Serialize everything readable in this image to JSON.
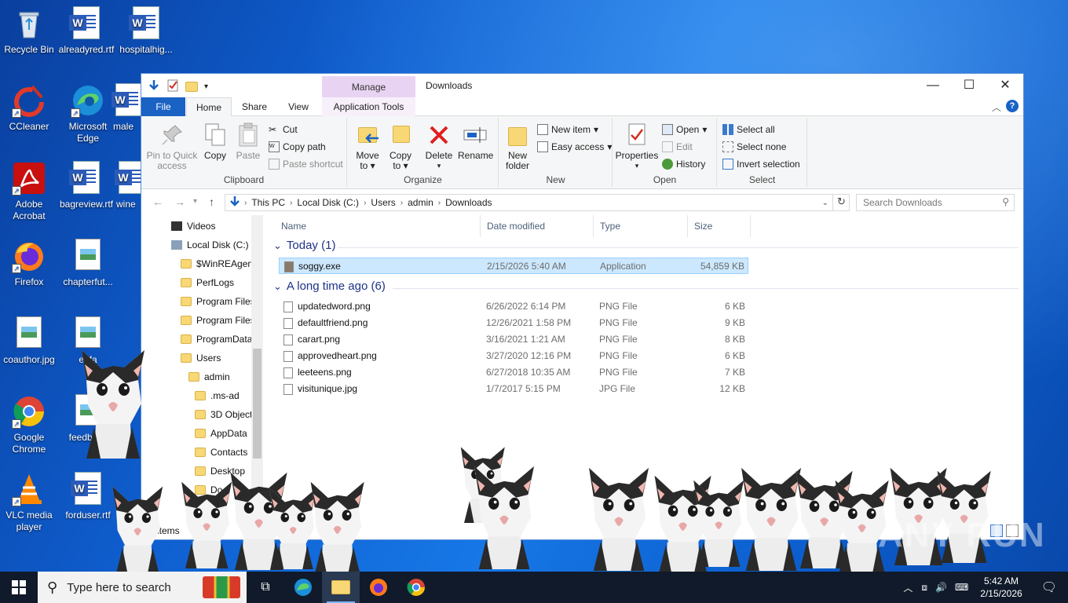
{
  "desktop": {
    "icons": [
      {
        "label": "Recycle Bin",
        "icon": "recycle-bin-icon"
      },
      {
        "label": "alreadyred.rtf",
        "icon": "word-doc-icon"
      },
      {
        "label": "hospitalhig...",
        "icon": "word-doc-icon"
      },
      {
        "label": "CCleaner",
        "icon": "ccleaner-icon"
      },
      {
        "label": "Microsoft Edge",
        "icon": "edge-icon"
      },
      {
        "label": "male",
        "icon": "word-doc-icon"
      },
      {
        "label": "Adobe Acrobat",
        "icon": "acrobat-icon"
      },
      {
        "label": "bagreview.rtf",
        "icon": "word-doc-icon"
      },
      {
        "label": "wine",
        "icon": "word-doc-icon"
      },
      {
        "label": "Firefox",
        "icon": "firefox-icon"
      },
      {
        "label": "chapterfut...",
        "icon": "image-file-icon"
      },
      {
        "label": "coauthor.jpg",
        "icon": "image-file-icon"
      },
      {
        "label": "egfa",
        "icon": "image-file-icon"
      },
      {
        "label": "Google Chrome",
        "icon": "chrome-icon"
      },
      {
        "label": "feedback",
        "icon": "image-file-icon"
      },
      {
        "label": "VLC media player",
        "icon": "vlc-icon"
      },
      {
        "label": "forduser.rtf",
        "icon": "word-doc-icon"
      }
    ]
  },
  "explorer": {
    "title": "Downloads",
    "manage_tab": "Manage",
    "tabs": {
      "file": "File",
      "home": "Home",
      "share": "Share",
      "view": "View",
      "apptools": "Application Tools"
    },
    "ribbon": {
      "clipboard": {
        "label": "Clipboard",
        "pin": "Pin to Quick access",
        "copy": "Copy",
        "paste": "Paste",
        "cut": "Cut",
        "copy_path": "Copy path",
        "paste_shortcut": "Paste shortcut"
      },
      "organize": {
        "label": "Organize",
        "move_to": "Move to",
        "copy_to": "Copy to",
        "delete": "Delete",
        "rename": "Rename"
      },
      "new": {
        "label": "New",
        "new_folder": "New folder",
        "new_item": "New item",
        "easy_access": "Easy access"
      },
      "open": {
        "label": "Open",
        "properties": "Properties",
        "open": "Open",
        "edit": "Edit",
        "history": "History"
      },
      "select": {
        "label": "Select",
        "select_all": "Select all",
        "select_none": "Select none",
        "invert": "Invert selection"
      }
    },
    "address": {
      "crumbs": [
        "This PC",
        "Local Disk (C:)",
        "Users",
        "admin",
        "Downloads"
      ],
      "search_placeholder": "Search Downloads"
    },
    "nav": [
      {
        "label": "Videos",
        "indent": 1
      },
      {
        "label": "Local Disk (C:)",
        "indent": 1
      },
      {
        "label": "$WinREAgent",
        "indent": 2
      },
      {
        "label": "PerfLogs",
        "indent": 2
      },
      {
        "label": "Program Files",
        "indent": 2
      },
      {
        "label": "Program Files",
        "indent": 2
      },
      {
        "label": "ProgramData",
        "indent": 2
      },
      {
        "label": "Users",
        "indent": 2
      },
      {
        "label": "admin",
        "indent": 3
      },
      {
        "label": ".ms-ad",
        "indent": 4
      },
      {
        "label": "3D Objects",
        "indent": 4
      },
      {
        "label": "AppData",
        "indent": 4
      },
      {
        "label": "Contacts",
        "indent": 4
      },
      {
        "label": "Desktop",
        "indent": 4
      },
      {
        "label": "Do",
        "indent": 4
      },
      {
        "label": "Do",
        "indent": 4
      }
    ],
    "columns": {
      "name": "Name",
      "date": "Date modified",
      "type": "Type",
      "size": "Size"
    },
    "groups": [
      {
        "title": "Today (1)",
        "files": [
          {
            "name": "soggy.exe",
            "date": "2/15/2026 5:40 AM",
            "type": "Application",
            "size": "54,859 KB",
            "selected": true
          }
        ]
      },
      {
        "title": "A long time ago (6)",
        "files": [
          {
            "name": "updatedword.png",
            "date": "6/26/2022 6:14 PM",
            "type": "PNG File",
            "size": "6 KB"
          },
          {
            "name": "defaultfriend.png",
            "date": "12/26/2021 1:58 PM",
            "type": "PNG File",
            "size": "9 KB"
          },
          {
            "name": "carart.png",
            "date": "3/16/2021 1:21 AM",
            "type": "PNG File",
            "size": "8 KB"
          },
          {
            "name": "approvedheart.png",
            "date": "3/27/2020 12:16 PM",
            "type": "PNG File",
            "size": "6 KB"
          },
          {
            "name": "leeteens.png",
            "date": "6/27/2018 10:35 AM",
            "type": "PNG File",
            "size": "7 KB"
          },
          {
            "name": "visitunique.jpg",
            "date": "1/7/2017 5:15 PM",
            "type": "JPG File",
            "size": "12 KB"
          }
        ]
      }
    ],
    "status": {
      "items_label": "items",
      "items_prefix": "1"
    }
  },
  "taskbar": {
    "search_placeholder": "Type here to search",
    "time": "5:42 AM",
    "date": "2/15/2026"
  },
  "watermark": "ANY RUN",
  "colors": {
    "accent": "#1a62c4",
    "selection": "#cce8ff",
    "manage": "#e8d4f2"
  }
}
